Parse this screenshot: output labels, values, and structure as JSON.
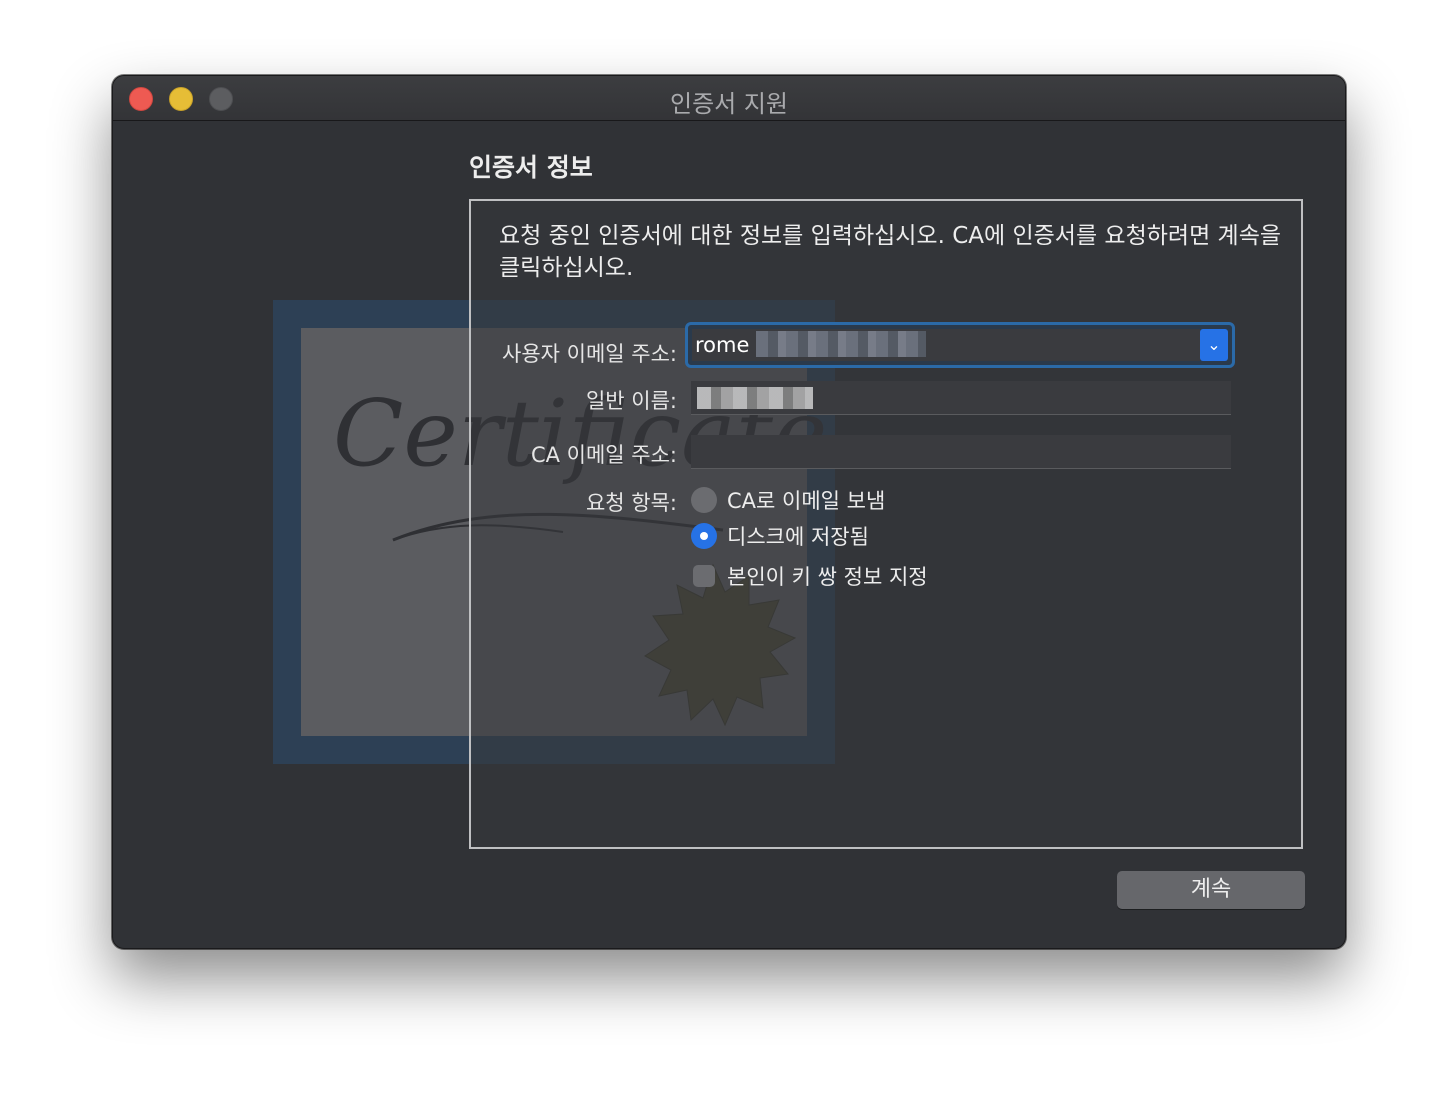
{
  "window": {
    "title": "인증서 지원"
  },
  "section": {
    "title": "인증서 정보",
    "description": "요청 중인 인증서에 대한 정보를 입력하십시오. CA에 인증서를 요청하려면 계속을 클릭하십시오."
  },
  "illustration": {
    "text": "Certificate"
  },
  "form": {
    "email_label": "사용자 이메일 주소:",
    "email_value": "rome",
    "common_name_label": "일반 이름:",
    "ca_email_label": "CA 이메일 주소:",
    "request_label": "요청 항목:",
    "options": [
      {
        "label": "CA로 이메일 보냄",
        "selected": false
      },
      {
        "label": "디스크에 저장됨",
        "selected": true
      }
    ],
    "checkbox_label": "본인이 키 쌍 정보 지정",
    "checkbox_checked": false
  },
  "buttons": {
    "continue": "계속"
  },
  "colors": {
    "accent": "#2672e6",
    "window_bg": "#303236",
    "close": "#ee5a52",
    "minimize": "#e6bd36",
    "maximize": "#5c5d60"
  }
}
